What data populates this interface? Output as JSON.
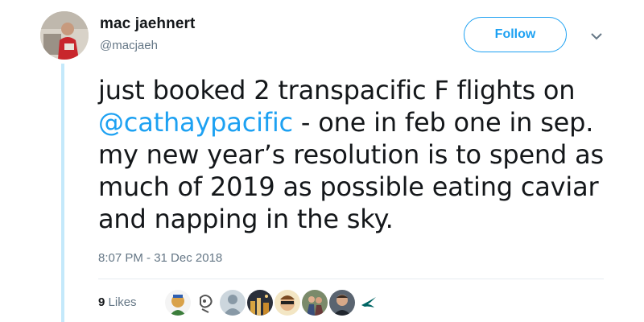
{
  "tweet": {
    "author": {
      "name": "mac jaehnert",
      "handle": "@macjaeh"
    },
    "follow_label": "Follow",
    "text_lines": [
      "just booked 2 transpacific F flights on",
      "@cathaypacific",
      " - one in feb one in sep.",
      "my new year’s resolution is to spend as",
      "much of 2019 as possible eating caviar",
      "and napping in the sky."
    ],
    "timestamp": "8:07 PM - 31 Dec 2018",
    "likes": {
      "count": "9",
      "label": "Likes"
    },
    "liker_avatars": [
      "liker-avatar-1",
      "liker-avatar-2",
      "liker-avatar-3",
      "liker-avatar-4",
      "liker-avatar-5",
      "liker-avatar-6",
      "liker-avatar-7",
      "liker-avatar-8"
    ]
  },
  "colors": {
    "accent": "#1da1f2",
    "muted": "#657786",
    "text": "#14171a",
    "thread_line": "#c4e9fb",
    "divider": "#e6ecf0"
  },
  "icons": {
    "caret": "chevron-down-icon",
    "brand": "cathay-pacific-brushwing-icon"
  }
}
